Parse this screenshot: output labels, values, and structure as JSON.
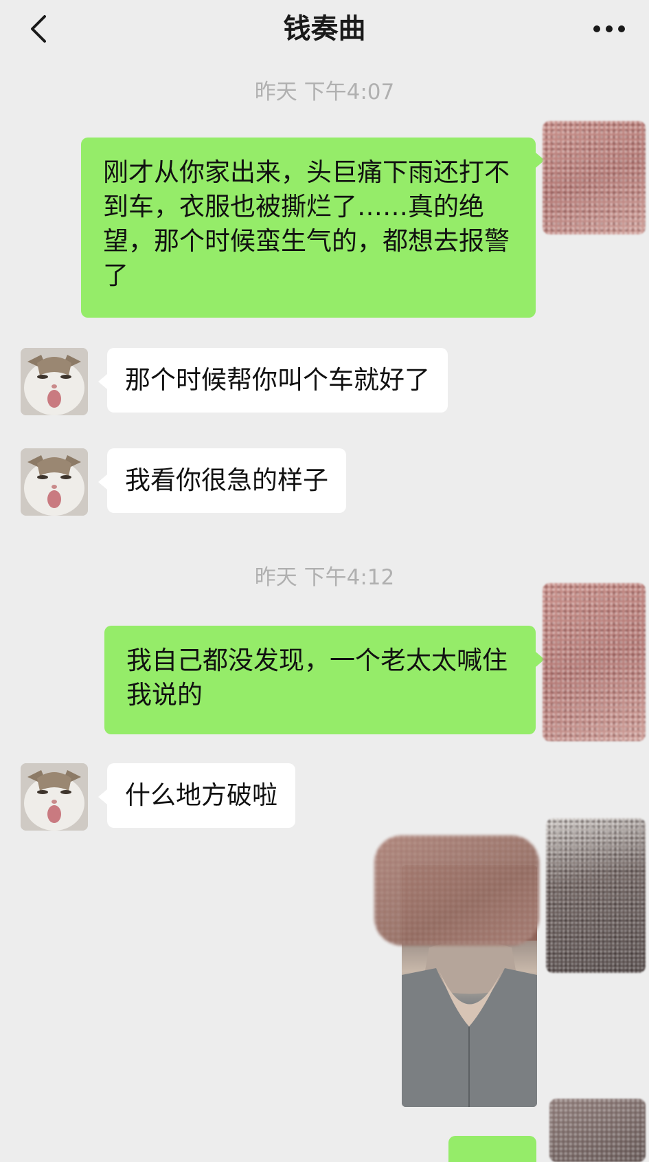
{
  "header": {
    "title": "钱奏曲",
    "back_icon": "chevron-left-icon",
    "more_icon": "ellipsis-icon"
  },
  "timestamps": [
    "昨天 下午4:07",
    "昨天 下午4:12"
  ],
  "messages": [
    {
      "sender": "me",
      "text": "刚才从你家出来，头巨痛下雨还打不到车，衣服也被撕烂了……真的绝望，那个时候蛮生气的，都想去报警了"
    },
    {
      "sender": "them",
      "text": "那个时候帮你叫个车就好了"
    },
    {
      "sender": "them",
      "text": "我看你很急的样子"
    },
    {
      "sender": "me",
      "text": "我自己都没发现，一个老太太喊住我说的"
    },
    {
      "sender": "them",
      "text": "什么地方破啦"
    },
    {
      "sender": "me",
      "type": "image"
    }
  ],
  "colors": {
    "background": "#ededed",
    "my_bubble": "#95ec69",
    "their_bubble": "#ffffff",
    "timestamp": "#b0b0b0"
  }
}
